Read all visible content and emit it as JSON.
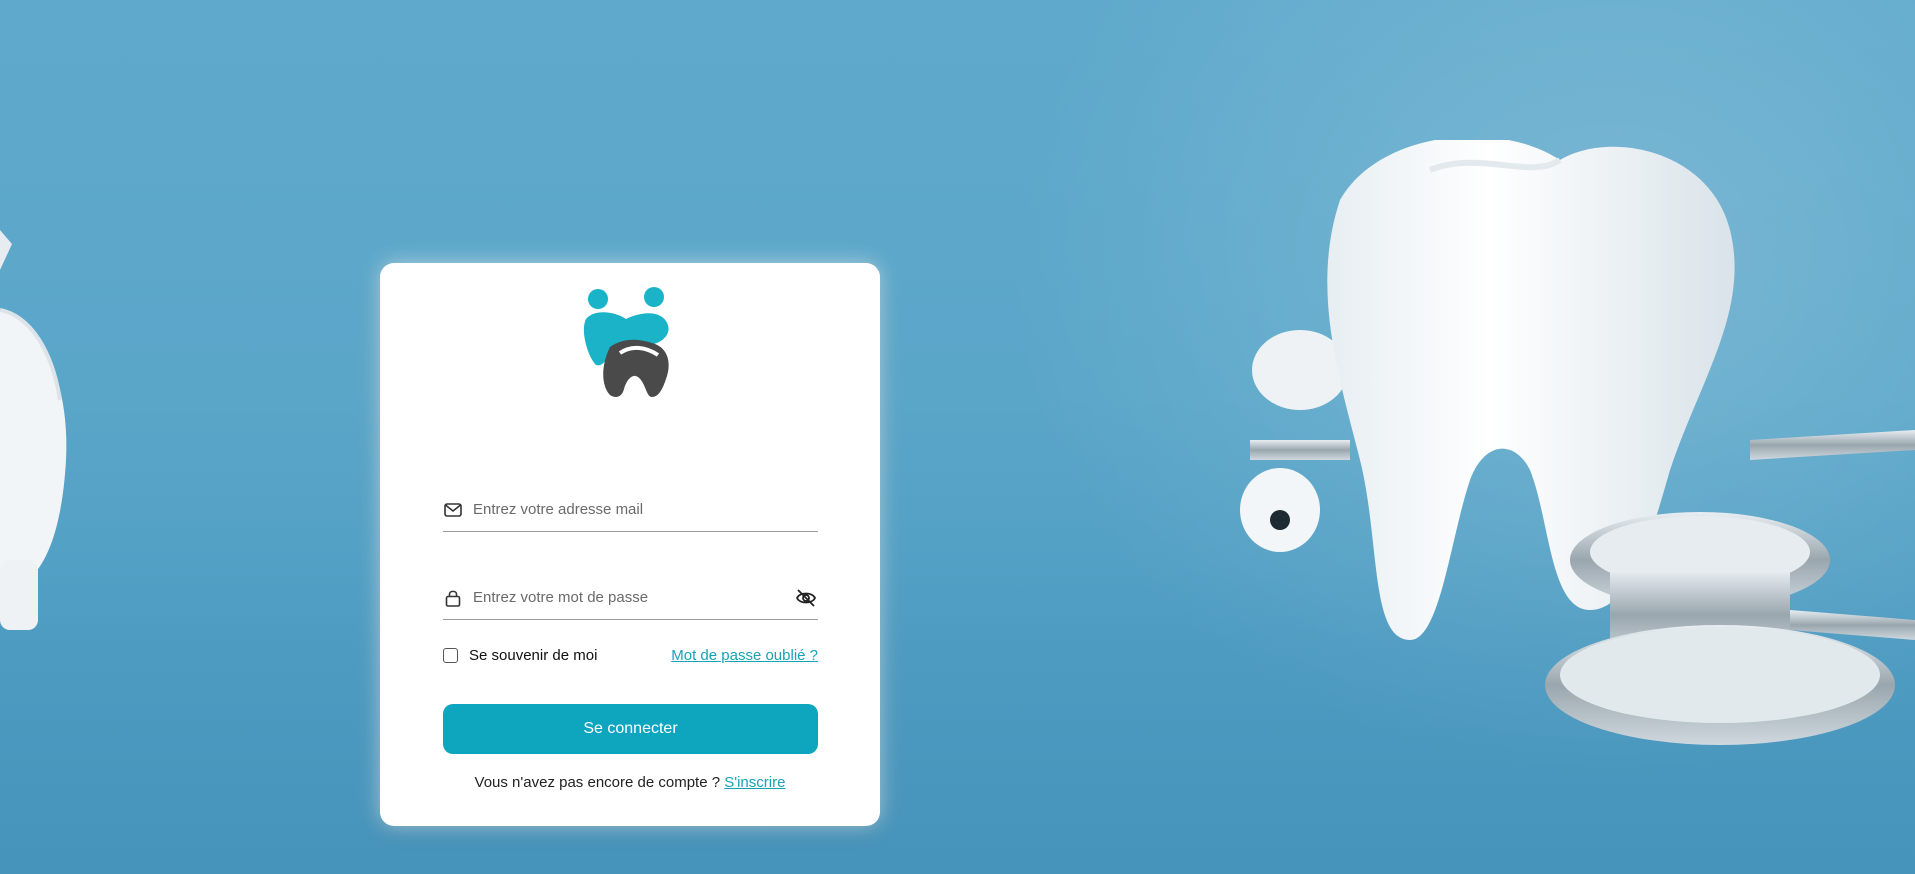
{
  "login": {
    "email_placeholder": "Entrez votre adresse mail",
    "password_placeholder": "Entrez votre mot de passe",
    "remember_label": "Se souvenir de moi",
    "remember_checked": false,
    "forgot_label": "Mot de passe oublié ?",
    "submit_label": "Se connecter",
    "signup_prompt": "Vous n'avez pas encore de compte ?",
    "signup_link": "S'inscrire"
  },
  "icons": {
    "logo": "tooth-family-logo",
    "email": "mail-icon",
    "password": "lock-icon",
    "toggle": "eye-off-icon"
  },
  "colors": {
    "accent": "#0ea5bf",
    "link": "#17a2b8",
    "logo_teal": "#1bb3c8",
    "logo_dark": "#4a4a4a",
    "background": "#5aa6c9"
  }
}
